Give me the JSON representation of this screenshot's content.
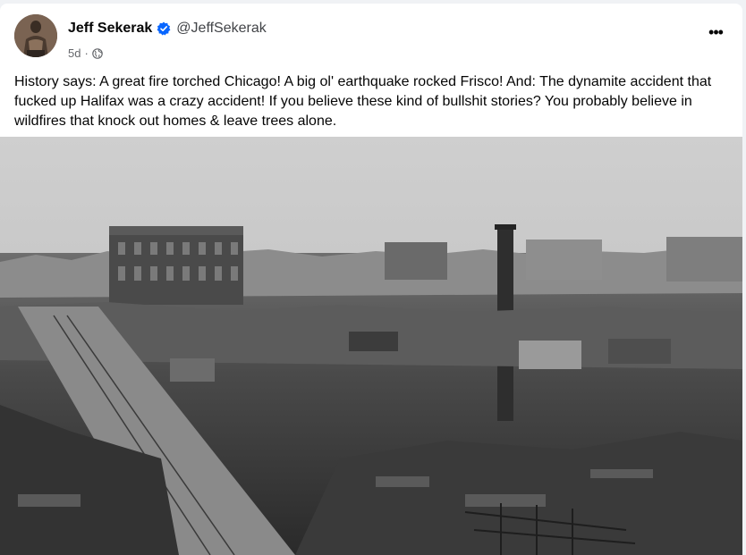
{
  "post": {
    "author": {
      "name": "Jeff Sekerak",
      "handle": "@JeffSekerak",
      "verified": true,
      "avatar_icon": "profile-photo-avatar"
    },
    "timestamp": "5d",
    "separator": "·",
    "audience_icon": "globe-icon",
    "more_icon": "more-options-icon",
    "more_label": "•••",
    "text": "History says: A great fire torched Chicago! A big ol' earthquake rocked Frisco! And: The dynamite accident that fucked up Halifax was a crazy accident! If you believe these kind of bullshit stories? You probably believe in wildfires that knock out homes & leave trees alone.",
    "image": {
      "subject": "black-and-white photo of a burned city"
    }
  },
  "colors": {
    "verified_blue": "#0866ff",
    "secondary_text": "#65676b",
    "background": "#f0f2f5"
  }
}
